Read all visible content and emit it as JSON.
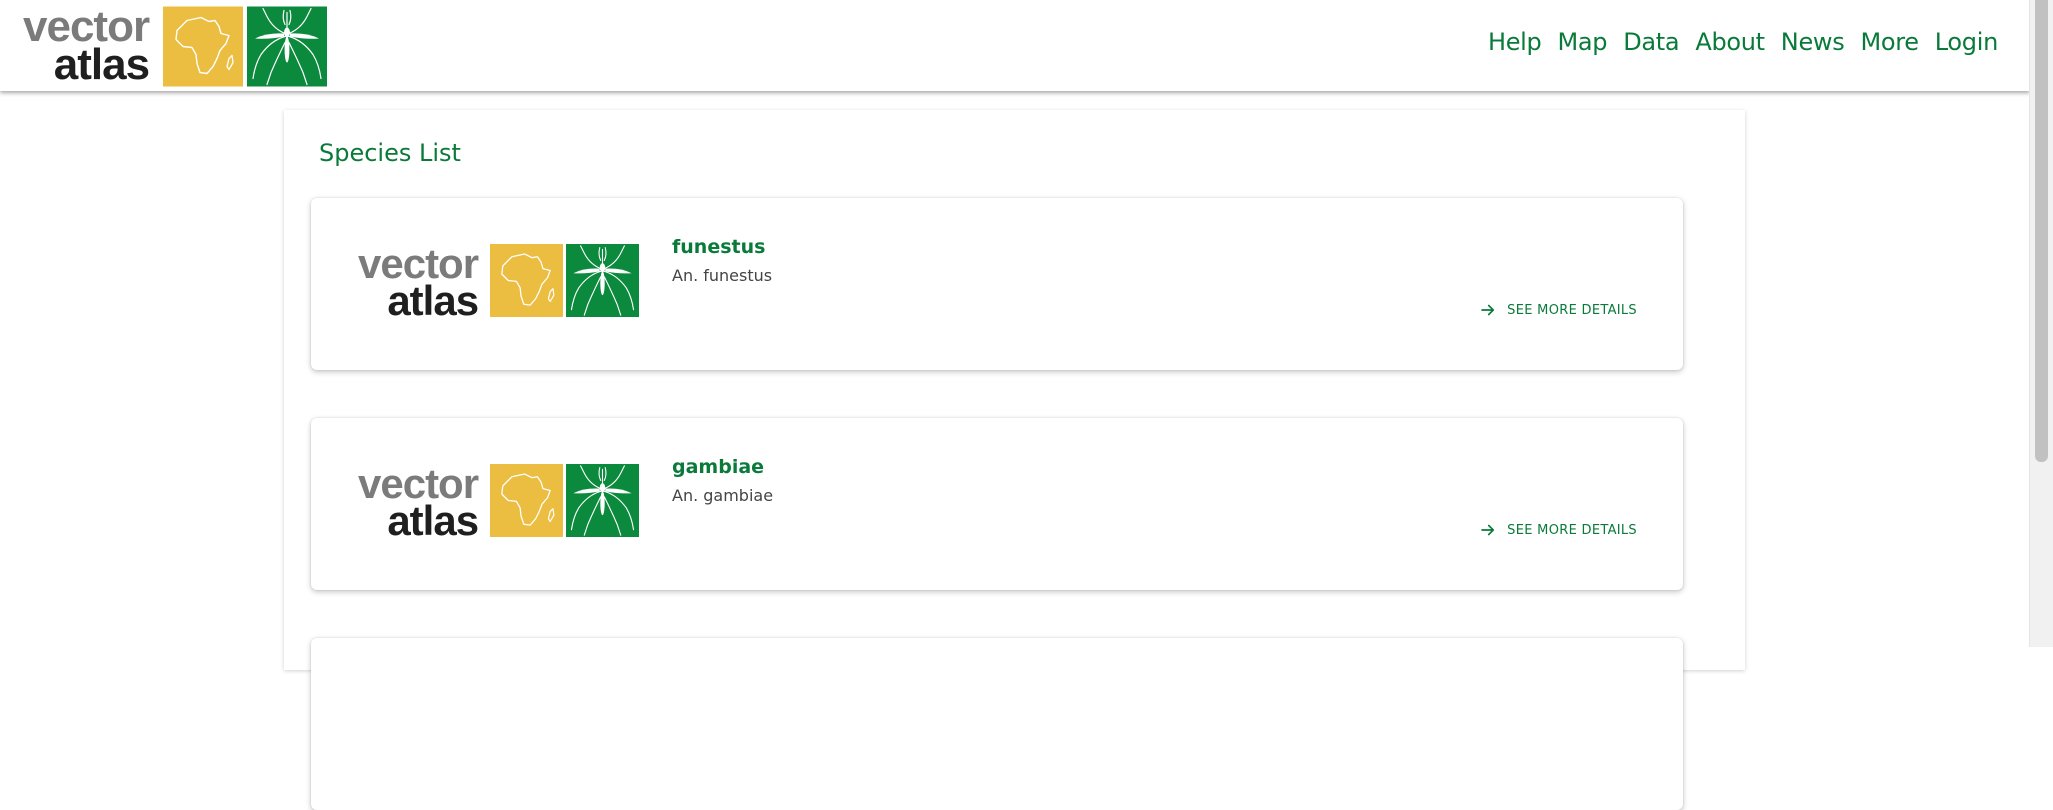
{
  "brand": {
    "word1": "vector",
    "word2": "atlas"
  },
  "nav": [
    {
      "label": "Help"
    },
    {
      "label": "Map"
    },
    {
      "label": "Data"
    },
    {
      "label": "About"
    },
    {
      "label": "News"
    },
    {
      "label": "More"
    },
    {
      "label": "Login"
    }
  ],
  "page": {
    "title": "Species List"
  },
  "species": [
    {
      "name": "funestus",
      "full_name": "An. funestus",
      "details_label": "SEE MORE DETAILS"
    },
    {
      "name": "gambiae",
      "full_name": "An. gambiae",
      "details_label": "SEE MORE DETAILS"
    }
  ],
  "colors": {
    "brand_green": "#0a7a3a",
    "tile_green": "#0b8a3e",
    "tile_yellow": "#ebbd40",
    "wordmark_grey": "#7b7b7b",
    "wordmark_dark": "#1f1f1f"
  },
  "icons": {
    "africa_tile": "africa-map-icon",
    "mosquito_tile": "mosquito-icon",
    "arrow": "arrow-right-icon"
  }
}
